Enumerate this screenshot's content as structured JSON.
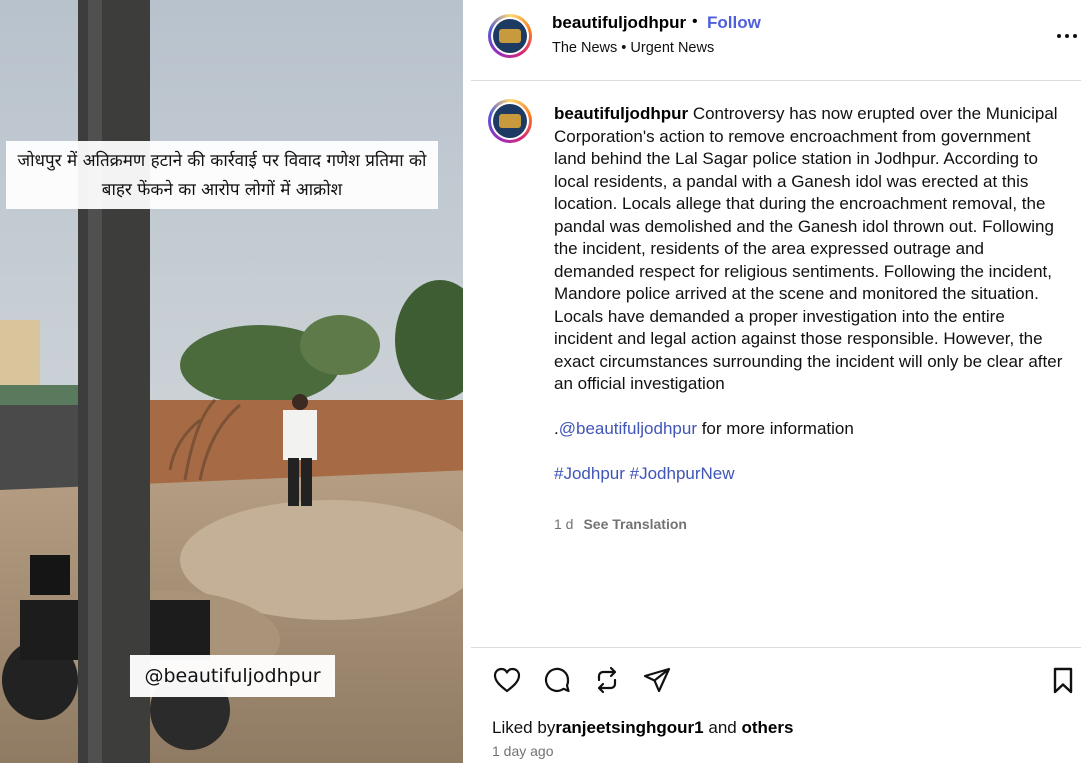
{
  "media": {
    "overlay_caption": "जोधपुर में अतिक्रमण हटाने की कार्रवाई पर विवाद गणेश प्रतिमा को बाहर फेंकने का आरोप लोगों में आक्रोश",
    "watermark": "@beautifuljodhpur"
  },
  "header": {
    "username": "beautifuljodhpur",
    "separator": "•",
    "follow_label": "Follow",
    "subtitle": "The News • Urgent News",
    "more_icon": "more-horizontal-icon"
  },
  "post": {
    "username": "beautifuljodhpur",
    "caption": "Controversy has now erupted over the Municipal Corporation's action to remove encroachment from government land behind the Lal Sagar police station in Jodhpur. According to local residents, a pandal with a Ganesh idol was erected at this location. Locals allege that during the encroachment removal, the pandal was demolished and the Ganesh idol thrown out. Following the incident, residents of the area expressed outrage and demanded respect for religious sentiments. Following the incident, Mandore police arrived at the scene and monitored the situation. Locals have demanded a proper investigation into the entire incident and legal action against those responsible. However, the exact circumstances surrounding the incident will only be clear after an official investigation",
    "mention_prefix": ".",
    "mention": "@beautifuljodhpur",
    "mention_suffix": " for more information",
    "hashtag_1": "#Jodhpur",
    "hashtag_2": "#JodhpurNew",
    "age": "1 d",
    "see_translation": "See Translation"
  },
  "actions": {
    "icons": [
      "heart-icon",
      "comment-icon",
      "repost-icon",
      "share-icon",
      "bookmark-icon"
    ]
  },
  "likes": {
    "prefix": "Liked by",
    "user": "ranjeetsinghgour1",
    "middle": " and ",
    "others": "others"
  },
  "timestamp": "1 day ago",
  "colors": {
    "link": "#4055b8",
    "follow": "#4f5fdc",
    "muted": "#737373",
    "divider": "#dbdbdb"
  }
}
